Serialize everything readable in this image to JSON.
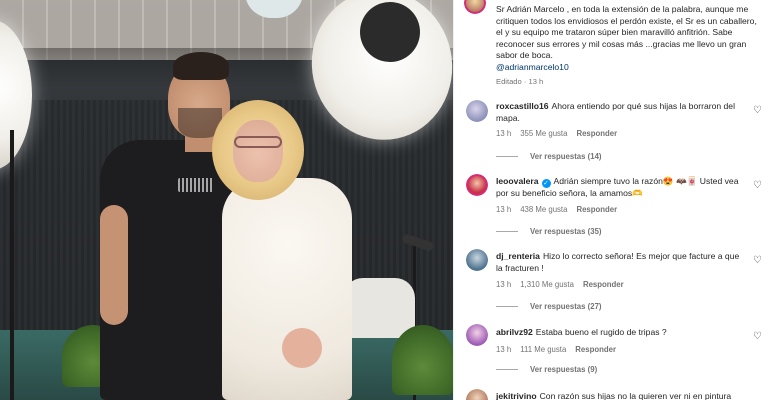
{
  "caption": {
    "text": "Sr Adrián Marcelo , en toda la extensión de la palabra, aunque me critiquen todos los envidiosos el perdón existe, el Sr es un caballero, el y su equipo me trataron súper bien maravilló anfitrión. Sabe reconocer sus errores y mil cosas más ...gracias me llevo un gran sabor de boca.",
    "mention": "@adrianmarcelo10",
    "edited": "Editado · 13 h"
  },
  "comments": [
    {
      "username": "roxcastillo16",
      "verified": false,
      "text": "Ahora entiendo por qué sus hijas la borraron del mapa.",
      "time": "13 h",
      "likes": "355 Me gusta",
      "reply_label": "Responder",
      "replies": "Ver respuestas (14)",
      "avatar_color": "#8a8fb8"
    },
    {
      "username": "leoovalera",
      "verified": true,
      "verified_icon": "✓",
      "text": "Adrián siempre tuvo la razón😍 🦇🀄 Usted vea por su beneficio señora, la amamos🫶",
      "time": "13 h",
      "likes": "438 Me gusta",
      "reply_label": "Responder",
      "replies": "Ver respuestas (35)",
      "avatar_color": "#c8324a"
    },
    {
      "username": "dj_renteria",
      "verified": false,
      "text": "Hizo lo correcto señora! Es mejor que facture a que la fracturen !",
      "time": "13 h",
      "likes": "1,310 Me gusta",
      "reply_label": "Responder",
      "replies": "Ver respuestas (27)",
      "avatar_color": "#4a6f8c"
    },
    {
      "username": "abrilvz92",
      "verified": false,
      "text": "Estaba bueno el rugido de tripas ?",
      "time": "13 h",
      "likes": "111 Me gusta",
      "reply_label": "Responder",
      "replies": "Ver respuestas (9)",
      "avatar_color": "#9b59b6"
    },
    {
      "username": "jekitrivino",
      "verified": false,
      "text": "Con razón sus hijas no la quieren ver ni en pintura",
      "avatar_color": "#b07a5a"
    }
  ],
  "icons": {
    "heart": "♡"
  }
}
